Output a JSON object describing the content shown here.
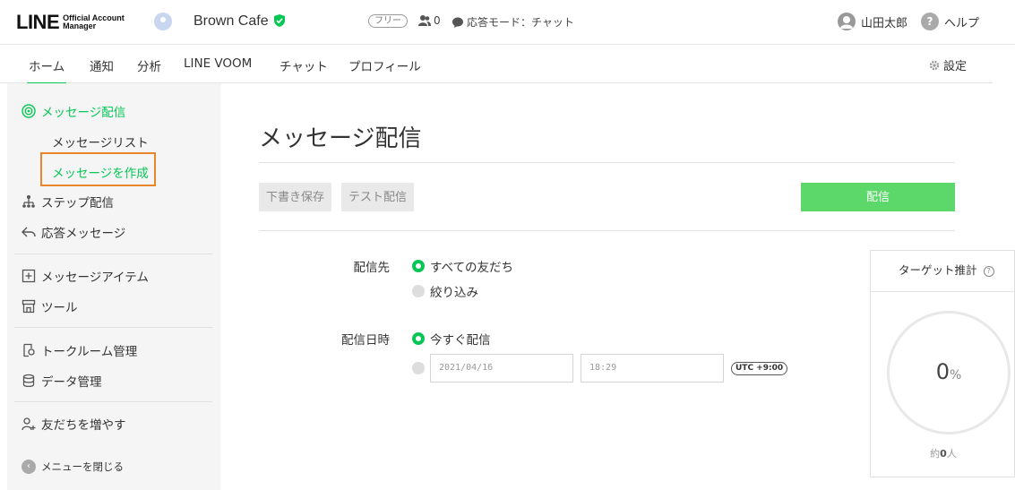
{
  "header": {
    "logo_main": "LINE",
    "logo_sub_1": "Official Account",
    "logo_sub_2": "Manager",
    "account_name": "Brown Cafe",
    "plan": "フリー",
    "friends_count": "0",
    "mode_label": "応答モード：チャット",
    "user_name": "山田太郎",
    "help_label": "ヘルプ"
  },
  "nav": {
    "tabs": [
      "ホーム",
      "通知",
      "分析",
      "LINE VOOM",
      "チャット",
      "プロフィール"
    ],
    "settings_label": "設定"
  },
  "sidebar": {
    "section_broadcast": "メッセージ配信",
    "sub_list": "メッセージリスト",
    "sub_create": "メッセージを作成",
    "step": "ステップ配信",
    "auto_reply": "応答メッセージ",
    "items": "メッセージアイテム",
    "tools": "ツール",
    "talkroom": "トークルーム管理",
    "data": "データ管理",
    "add_friends": "友だちを増やす",
    "close_menu": "メニューを閉じる"
  },
  "main": {
    "title": "メッセージ配信",
    "draft_button": "下書き保存",
    "test_button": "テスト配信",
    "send_button": "配信",
    "recipient_label": "配信先",
    "recipient_all": "すべての友だち",
    "recipient_filter": "絞り込み",
    "datetime_label": "配信日時",
    "send_now": "今すぐ配信",
    "date_value": "2021/04/16",
    "time_value": "18:29",
    "timezone": "UTC +9:00"
  },
  "target": {
    "title": "ターゲット推計",
    "percent_value": "0",
    "percent_unit": "%",
    "count_prefix": "約",
    "count_value": "0",
    "count_unit": "人"
  },
  "colors": {
    "accent": "#06c755",
    "send_button": "#5cd86b",
    "highlight": "#e8862c"
  }
}
